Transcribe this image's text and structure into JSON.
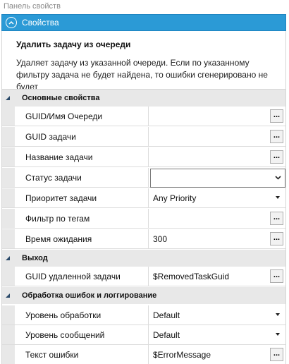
{
  "panel_title": "Панель свойств",
  "header": {
    "title": "Свойства"
  },
  "action": {
    "title": "Удалить задачу из очереди",
    "description": "Удаляет задачу из указанной очереди. Если по указанному фильтру задача не будет найдена, то ошибки сгенерировано не будет"
  },
  "sections": {
    "basic": {
      "title": "Основные свойства",
      "rows": [
        {
          "label": "GUID/Имя Очереди",
          "value": ""
        },
        {
          "label": "GUID задачи",
          "value": ""
        },
        {
          "label": "Название задачи",
          "value": ""
        },
        {
          "label": "Статус задачи",
          "value": ""
        },
        {
          "label": "Приоритет задачи",
          "value": "Any Priority"
        },
        {
          "label": "Фильтр по тегам",
          "value": ""
        },
        {
          "label": "Время ожидания",
          "value": "300"
        }
      ]
    },
    "output": {
      "title": "Выход",
      "rows": [
        {
          "label": "GUID удаленной задачи",
          "value": "$RemovedTaskGuid"
        }
      ]
    },
    "errors": {
      "title": "Обработка ошибок и логгирование",
      "rows": [
        {
          "label": "Уровень обработки",
          "value": "Default"
        },
        {
          "label": "Уровень сообщений",
          "value": "Default"
        },
        {
          "label": "Текст ошибки",
          "value": "$ErrorMessage"
        }
      ]
    }
  },
  "ellipsis_label": "...",
  "colors": {
    "accent": "#2b9ad6",
    "section_bg": "#e8e8e8",
    "border": "#dcdcdc"
  }
}
